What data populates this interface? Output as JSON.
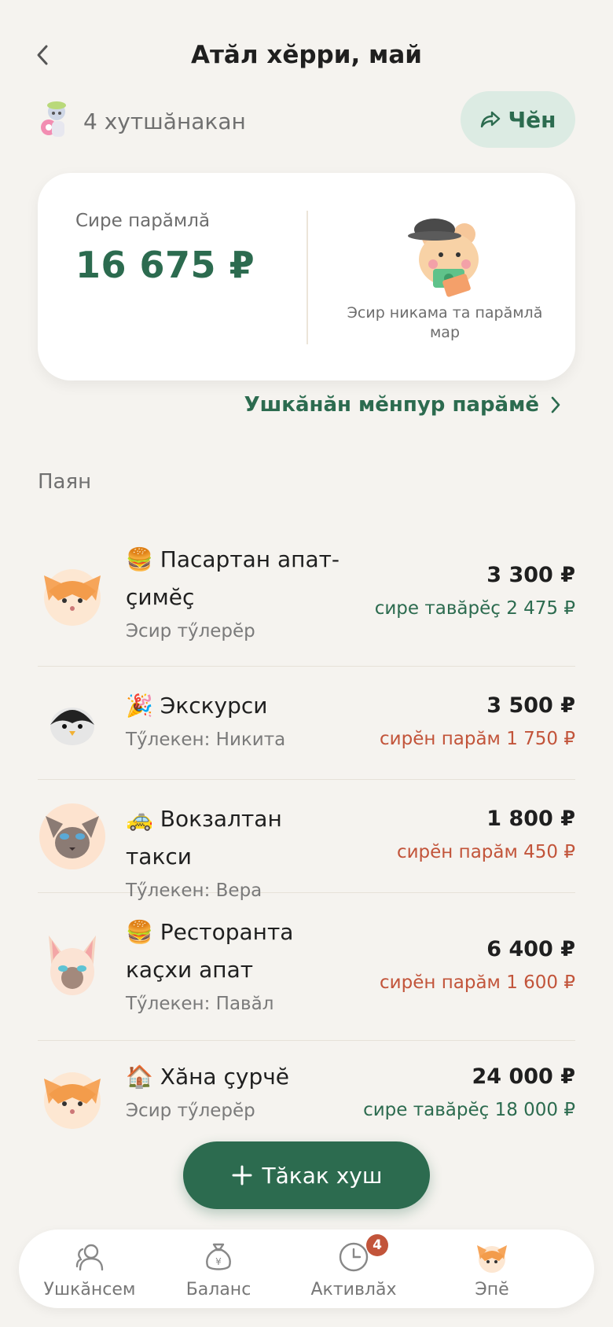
{
  "header": {
    "title": "Атăл хĕрри, май"
  },
  "members": {
    "count_label": "4 хутшăнакан"
  },
  "share_button": {
    "label": "Чĕн"
  },
  "summary": {
    "label": "Сире парăмлă",
    "amount": "16 675 ₽",
    "note": "Эсир никама та парăмлă мар"
  },
  "details_link": {
    "label": "Ушкăнăн мĕнпур парăмĕ"
  },
  "section": {
    "title": "Паян"
  },
  "expenses": [
    {
      "emoji": "🍔",
      "name": "Пасартан апат-çимĕç",
      "payer": "Эсир тӳлерĕр",
      "amount": "3 300 ₽",
      "status": "сире тавăрĕç 2 475 ₽",
      "status_color": "#2c6b4f",
      "avatar": "fox-icon"
    },
    {
      "emoji": "🎉",
      "name": "Экскурси",
      "payer": "Тӳлекен: Никита",
      "amount": "3 500 ₽",
      "status": "сирĕн парăм 1 750 ₽",
      "status_color": "#c2543a",
      "avatar": "penguin-icon"
    },
    {
      "emoji": "🚕",
      "name": "Вокзалтан такси",
      "payer": "Тӳлекен: Вера",
      "amount": "1 800 ₽",
      "status": "сирĕн парăм 450 ₽",
      "status_color": "#c2543a",
      "avatar": "siamese-cat-icon"
    },
    {
      "emoji": "🍔",
      "name": "Ресторанта каçхи апат",
      "payer": "Тӳлекен: Павăл",
      "amount": "6 400 ₽",
      "status": "сирĕн парăм 1 600 ₽",
      "status_color": "#c2543a",
      "avatar": "sphynx-cat-icon"
    },
    {
      "emoji": "🏠",
      "name": "Хăна çурчĕ",
      "payer": "Эсир тӳлерĕр",
      "amount": "24 000 ₽",
      "status": "сире тавăрĕç 18 000 ₽",
      "status_color": "#2c6b4f",
      "avatar": "fox-icon"
    }
  ],
  "fab": {
    "label": "Тăкак хуш"
  },
  "tabbar": {
    "tabs": [
      {
        "label": "Ушкăнсем",
        "icon": "people-icon"
      },
      {
        "label": "Баланс",
        "icon": "money-bag-icon"
      },
      {
        "label": "Активлăх",
        "icon": "clock-icon",
        "badge": "4"
      },
      {
        "label": "Эпĕ",
        "icon": "avatar-icon"
      }
    ]
  },
  "colors": {
    "accent": "#2c6b4f",
    "debt": "#c2543a",
    "background": "#f5f3ef"
  }
}
